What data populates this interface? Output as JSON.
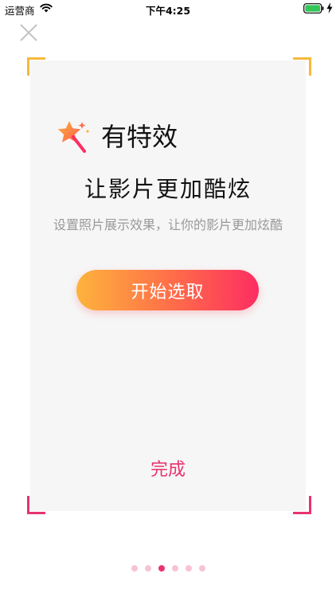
{
  "status_bar": {
    "carrier": "运营商",
    "time": "下午4:25",
    "icons": [
      "wifi-icon",
      "battery-icon",
      "charging-icon"
    ]
  },
  "header": {
    "close_icon": "close-icon"
  },
  "feature": {
    "icon": "magic-wand-icon",
    "title": "有特效",
    "headline": "让影片更加酷炫",
    "description": "设置照片展示效果，让你的影片更加炫酷",
    "start_button_label": "开始选取",
    "done_label": "完成"
  },
  "pagination": {
    "total": 6,
    "active_index": 2
  },
  "colors": {
    "accent_pink": "#e8336d",
    "accent_yellow": "#f6b93b",
    "gradient_start": "#fdb33c",
    "gradient_end": "#fd2d62",
    "card_background": "#f6f6f6"
  }
}
